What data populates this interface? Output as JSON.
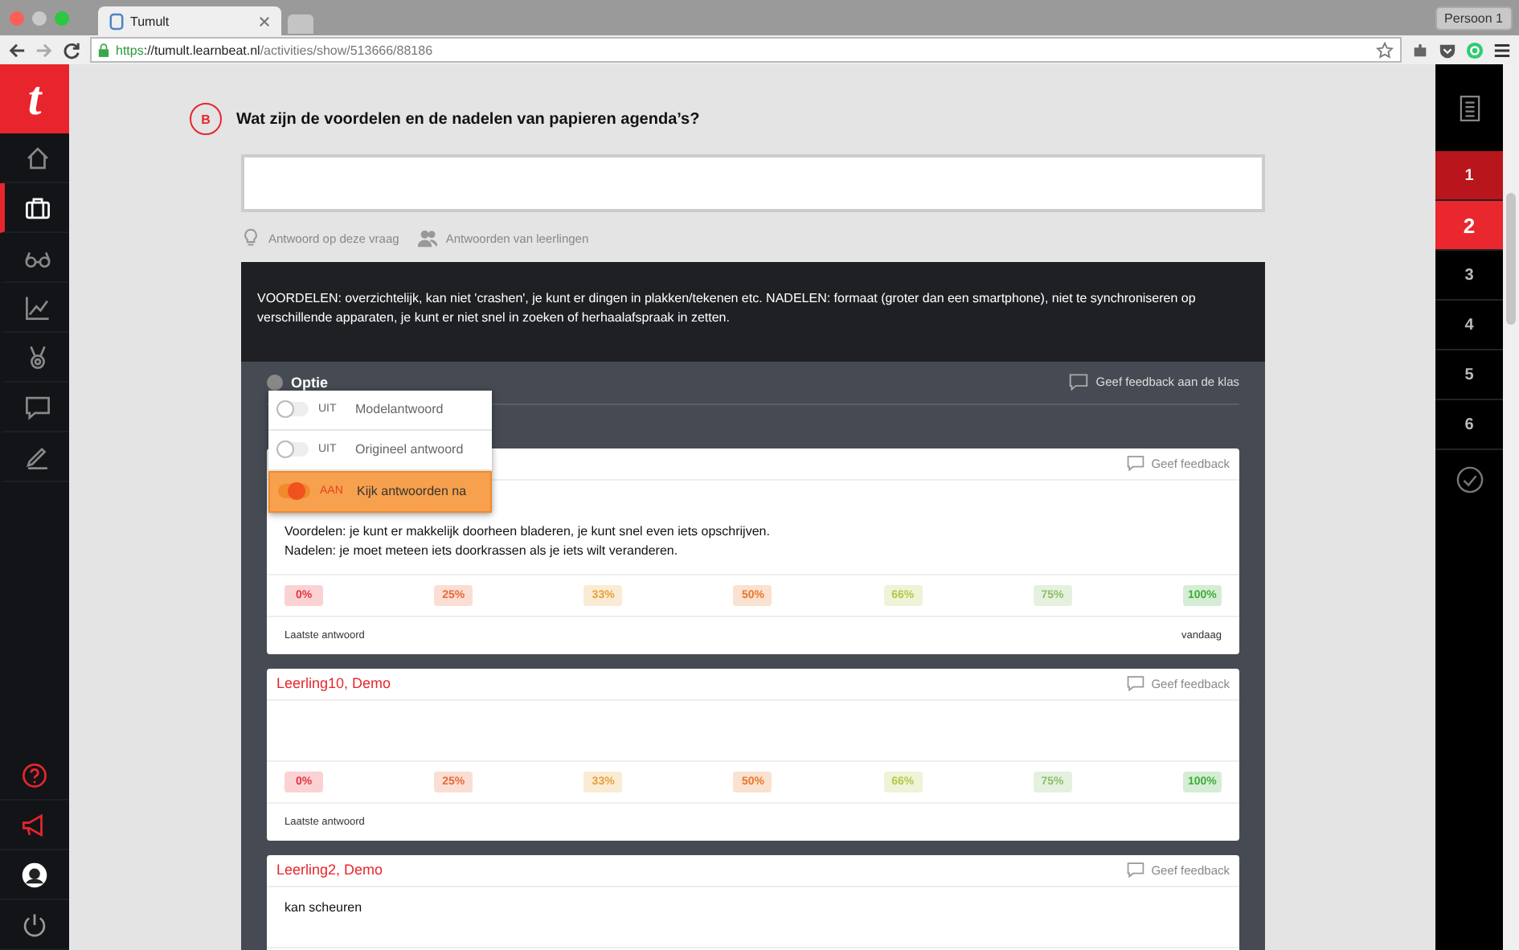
{
  "browser": {
    "tab_title": "Tumult",
    "url_scheme": "https",
    "url_host": "://tumult.learnbeat.nl",
    "url_path": "/activities/show/513666/88186",
    "profile": "Persoon 1"
  },
  "sidebar": {
    "logo": "t",
    "items": [
      {
        "selected": false
      },
      {
        "selected": true
      },
      {
        "selected": false
      },
      {
        "selected": false
      },
      {
        "selected": false
      },
      {
        "selected": false
      },
      {
        "selected": false
      }
    ]
  },
  "question": {
    "letter": "B",
    "title": "Wat zijn de voordelen en de nadelen van papieren agenda’s?",
    "links": [
      {
        "label": "Antwoord op deze vraag"
      },
      {
        "label": "Antwoorden van leerlingen"
      }
    ]
  },
  "model_answer": "VOORDELEN: overzichtelijk, kan niet 'crashen', je kunt er dingen in plakken/tekenen etc. NADELEN: formaat (groter dan een smartphone), niet te synchroniseren op verschillende apparaten, je kunt er niet snel in zoeken of herhaalafspraak in zetten.",
  "options": {
    "label": "Optie",
    "class_feedback": "Geef feedback aan de klas",
    "menu": [
      {
        "state_label": "UIT",
        "label": "Modelantwoord",
        "on": false
      },
      {
        "state_label": "UIT",
        "label": "Origineel antwoord",
        "on": false
      },
      {
        "state_label": "AAN",
        "label": "Kijk antwoorden na",
        "on": true
      }
    ]
  },
  "answers": [
    {
      "feedback": "Geef feedback",
      "text": "Voordelen: je kunt er makkelijk doorheen bladeren, je kunt snel even iets opschrijven.\nNadelen: je moet meteen iets doorkrassen als je iets wilt veranderen.",
      "footer_left": "Laatste antwoord",
      "footer_right": "vandaag",
      "scores": [
        {
          "label": "0%",
          "color": "#e8333c"
        },
        {
          "label": "25%",
          "color": "#e8683a"
        },
        {
          "label": "33%",
          "color": "#e8a23a"
        },
        {
          "label": "50%",
          "color": "#e8782a"
        },
        {
          "label": "66%",
          "color": "#b5c94a"
        },
        {
          "label": "75%",
          "color": "#8bbf6a"
        },
        {
          "label": "100%",
          "color": "#3fae3a"
        }
      ]
    },
    {
      "student": "Leerling10, Demo",
      "feedback": "Geef feedback",
      "footer_left": "Laatste antwoord",
      "scores": [
        {
          "label": "0%",
          "color": "#e8333c"
        },
        {
          "label": "25%",
          "color": "#e8683a"
        },
        {
          "label": "33%",
          "color": "#e8a23a"
        },
        {
          "label": "50%",
          "color": "#e8782a"
        },
        {
          "label": "66%",
          "color": "#b5c94a"
        },
        {
          "label": "75%",
          "color": "#8bbf6a"
        },
        {
          "label": "100%",
          "color": "#3fae3a"
        }
      ]
    },
    {
      "student": "Leerling2, Demo",
      "feedback": "Geef feedback",
      "text": "kan scheuren"
    }
  ],
  "question_nav": [
    {
      "label": "1",
      "done": true,
      "selected": false
    },
    {
      "label": "2",
      "done": false,
      "selected": true
    },
    {
      "label": "3",
      "done": false,
      "selected": false
    },
    {
      "label": "4",
      "done": false,
      "selected": false
    },
    {
      "label": "5",
      "done": false,
      "selected": false
    },
    {
      "label": "6",
      "done": false,
      "selected": false
    }
  ]
}
